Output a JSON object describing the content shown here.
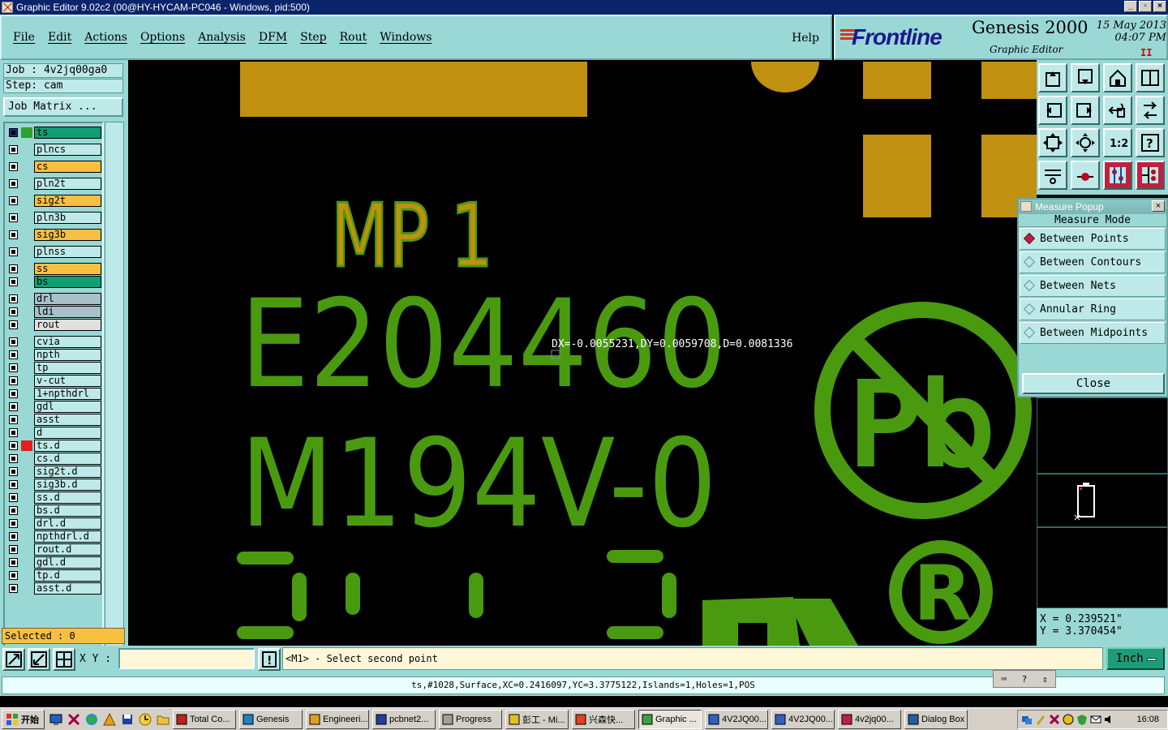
{
  "window": {
    "title": "Graphic Editor 9.02c2 (00@HY-HYCAM-PC046 - Windows, pid:500)",
    "min_label": "_",
    "max_label": "▫",
    "close_label": "×"
  },
  "menu": {
    "items": [
      "File",
      "Edit",
      "Actions",
      "Options",
      "Analysis",
      "DFM",
      "Step",
      "Rout",
      "Windows"
    ],
    "help": "Help"
  },
  "brand": {
    "logo": "Frontline",
    "product": "Genesis 2000",
    "subtitle": "Graphic Editor",
    "date": "15 May 2013",
    "time": "04:07 PM",
    "pause": "II"
  },
  "job": {
    "job_line": "Job : 4v2jq00ga0",
    "step_line": "Step: cam",
    "matrix_button": "Job Matrix ..."
  },
  "layers": [
    {
      "name": "ts",
      "color": "#0da070",
      "mark": "#30a030",
      "active": true
    },
    {
      "name": "plncs",
      "color": "#bde9e8"
    },
    {
      "name": "cs",
      "color": "#f8c040"
    },
    {
      "name": "pln2t",
      "color": "#bde9e8"
    },
    {
      "name": "sig2t",
      "color": "#f8c040"
    },
    {
      "name": "pln3b",
      "color": "#bde9e8"
    },
    {
      "name": "sig3b",
      "color": "#f8c040"
    },
    {
      "name": "plnss",
      "color": "#bde9e8"
    },
    {
      "name": "ss",
      "color": "#f8c040"
    },
    {
      "name": "bs",
      "color": "#0da070"
    },
    {
      "name": "drl",
      "color": "#a8c0c8"
    },
    {
      "name": "ldi",
      "color": "#a8c0c8"
    },
    {
      "name": "rout",
      "color": "#e0e0e0"
    },
    {
      "name": "cvia",
      "color": "#bde9e8"
    },
    {
      "name": "npth",
      "color": "#bde9e8"
    },
    {
      "name": "tp",
      "color": "#bde9e8"
    },
    {
      "name": "v-cut",
      "color": "#bde9e8"
    },
    {
      "name": "1+npthdrl",
      "color": "#bde9e8"
    },
    {
      "name": "gdl",
      "color": "#bde9e8"
    },
    {
      "name": "asst",
      "color": "#bde9e8"
    },
    {
      "name": "d",
      "color": "#bde9e8"
    },
    {
      "name": "ts.d",
      "color": "#bde9e8",
      "mark": "#e02020"
    },
    {
      "name": "cs.d",
      "color": "#bde9e8"
    },
    {
      "name": "sig2t.d",
      "color": "#bde9e8"
    },
    {
      "name": "sig3b.d",
      "color": "#bde9e8"
    },
    {
      "name": "ss.d",
      "color": "#bde9e8"
    },
    {
      "name": "bs.d",
      "color": "#bde9e8"
    },
    {
      "name": "drl.d",
      "color": "#bde9e8"
    },
    {
      "name": "npthdrl.d",
      "color": "#bde9e8"
    },
    {
      "name": "rout.d",
      "color": "#bde9e8"
    },
    {
      "name": "gdl.d",
      "color": "#bde9e8"
    },
    {
      "name": "tp.d",
      "color": "#bde9e8"
    },
    {
      "name": "asst.d",
      "color": "#bde9e8"
    }
  ],
  "selected": "Selected : 0",
  "canvas": {
    "text_mp1": "MP 1",
    "text_e": "E204460",
    "text_m": "M194V-0",
    "pb_text": "Pb",
    "reg_text": "R",
    "measure_readout": "DX=-0.0055231,DY=0.0059708,D=0.0081336",
    "silk_color": "#4a9a10",
    "pad_color": "#c09010"
  },
  "measure_popup": {
    "title": "Measure Popup",
    "heading": "Measure Mode",
    "options": [
      "Between Points",
      "Between Contours",
      "Between Nets",
      "Annular Ring",
      "Between Midpoints"
    ],
    "close": "Close"
  },
  "coords": {
    "x": "X = 0.239521\"",
    "y": "Y = 3.370454\""
  },
  "command": {
    "xy_label": "X Y :",
    "xy_value": "",
    "prompt_button": "!",
    "prompt": "<M1> - Select second point",
    "unit": "Inch"
  },
  "status": {
    "text": "ts,#1028,Surface,XC=0.2416097,YC=3.3775122,Islands=1,Holes=1,POS",
    "help_q": "?"
  },
  "taskbar": {
    "start": "开始",
    "tasks": [
      "Total Co...",
      "Genesis",
      "Engineeri...",
      "pcbnet2...",
      "Progress",
      "彭工 - Mi...",
      "兴森快...",
      "Graphic ...",
      "4V2JQ00...",
      "4V2JQ00...",
      "4v2jq00...",
      "Dialog Box"
    ],
    "active_index": 7,
    "clock": "16:08"
  }
}
